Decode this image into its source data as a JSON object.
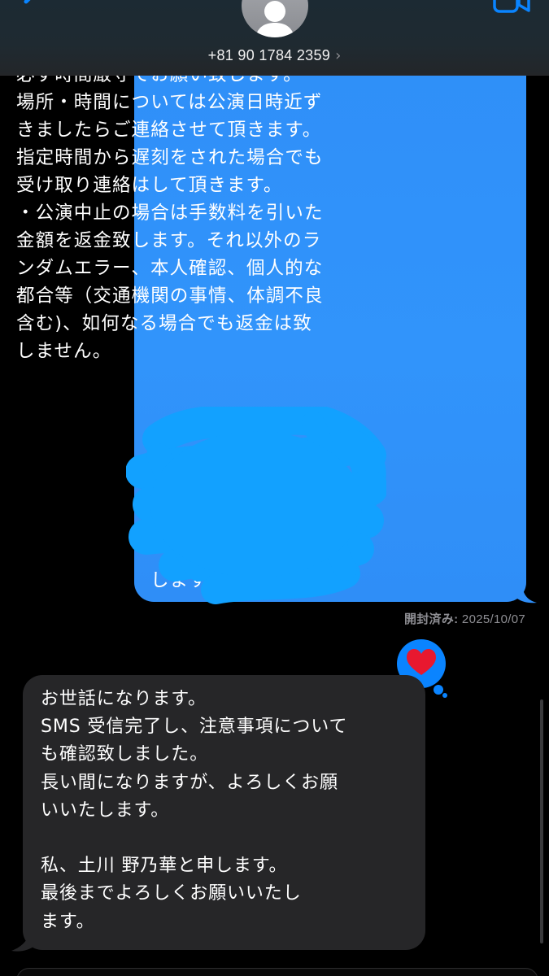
{
  "header": {
    "contact_number": "+81 90 1784 2359",
    "chevron": "›"
  },
  "messages": {
    "outgoing": {
      "text": "・当日は、こちらが指定した場所に\n必ず時間厳守でお願い致します。\n場所・時間については公演日時近ず\nきましたらご連絡させて頂きます。\n指定時間から遅刻をされた場合でも\n受け取り連絡はして頂きます。\n・公演中止の場合は手数料を引いた\n金額を返金致します。それ以外のラ\nンダムエラー、本人確認、個人的な\n都合等（交通機関の事情、体調不良\n含む)、如何なる場合でも返金は致\nしません。",
      "tail_text": "します",
      "read_label": "開封済み:",
      "read_date": "2025/10/07"
    },
    "tapback": {
      "icon": "heart-icon",
      "color": "#e8182f"
    },
    "incoming": {
      "text": "お世話になります。\nSMS 受信完了し、注意事項について\nも確認致しました。\n長い間になりますが、よろしくお願\nいいたします。\n\n私、土川 野乃華と申します。\n最後までよろしくお願いいたし\nます。"
    }
  },
  "colors": {
    "outgoing_bubble": "#3194fb",
    "incoming_bubble": "#262628",
    "redaction": "#1aa3ff",
    "accent": "#0a84ff"
  }
}
